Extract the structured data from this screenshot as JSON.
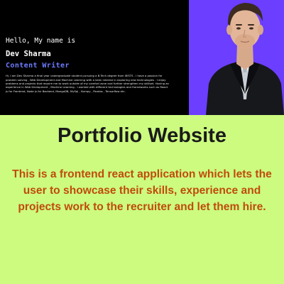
{
  "hero": {
    "greeting": "Hello, My name is",
    "name": "Dev Sharma",
    "role": "Content Writer",
    "bio": "Hi, I am Dev Sharma a final year undergraduate student pursuing a B.Tech degree from IIESTS . I have a passion for problem solving , Web Development and Machine Learning with a keen interest in exploring new technologies . I enjoy problems and projects that require me to work outside of my comfort zone and further strengthen my skillset. Having an experience in Web Devlopment , Machine Learning . I worked with different technologies and frameworks such as React js for Frontend, Node js for Backend, MongoDB, MySql , Numpy , Pandas , Tensorflow etc."
  },
  "main": {
    "title": "Portfolio Website",
    "description": "This is a frontend react application which lets the user to showcase their skills, experience and projects work to the recruiter and let them hire."
  },
  "colors": {
    "background": "#ccfb7f",
    "hero_background": "#000000",
    "accent_purple": "#6c3eff",
    "role_text": "#6d7bff",
    "description_text": "#c04b0c",
    "title_text": "#1a1a1a"
  },
  "icons": {
    "person": "person-photo"
  }
}
